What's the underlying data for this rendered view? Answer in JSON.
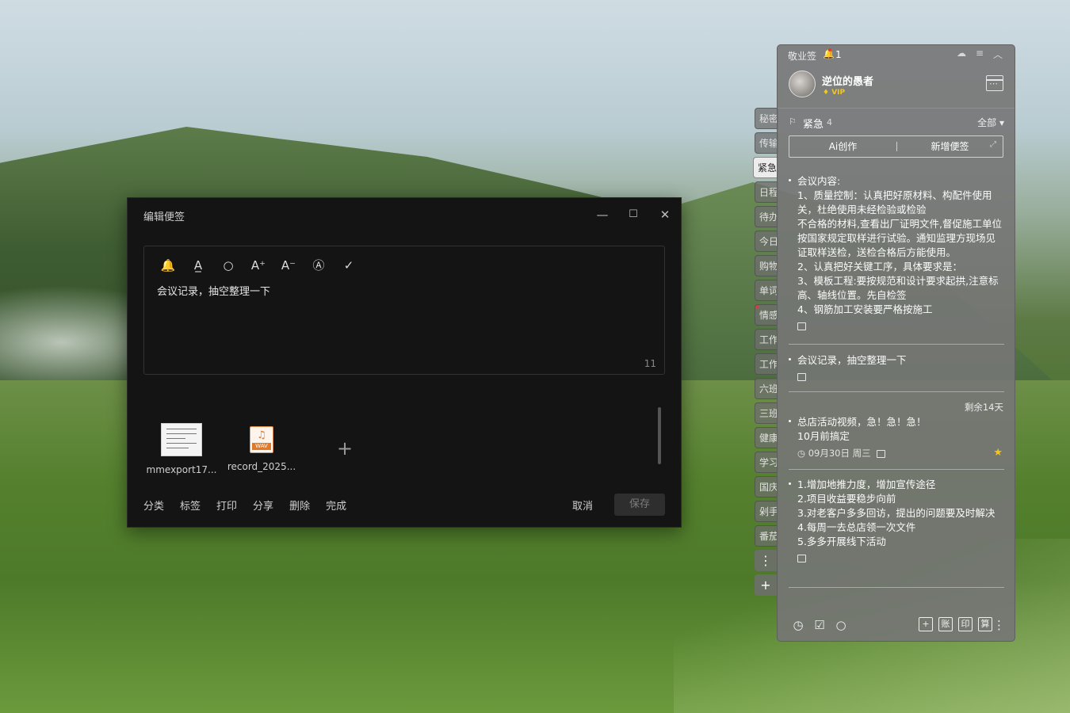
{
  "editor": {
    "title": "编辑便签",
    "minimize": "—",
    "maximize": "☐",
    "close": "✕",
    "toolbar": [
      {
        "name": "reminder-icon",
        "glyph": "🔔"
      },
      {
        "name": "text-color-icon",
        "glyph": "A̲"
      },
      {
        "name": "search-icon",
        "glyph": "○"
      },
      {
        "name": "font-increase-icon",
        "glyph": "A⁺"
      },
      {
        "name": "font-decrease-icon",
        "glyph": "A⁻"
      },
      {
        "name": "font-style-icon",
        "glyph": "Ⓐ"
      },
      {
        "name": "done-check-icon",
        "glyph": "✓"
      }
    ],
    "text": "会议记录，抽空整理一下",
    "char_count": "11",
    "attachments": [
      {
        "name": "mmexport17...",
        "type": "image"
      },
      {
        "name": "record_2025...",
        "type": "wav",
        "label": "WAV",
        "glyph": "♫"
      }
    ],
    "add_attachment": "+",
    "bottom_actions": [
      "分类",
      "标签",
      "打印",
      "分享",
      "删除",
      "完成"
    ],
    "cancel": "取消",
    "save": "保存"
  },
  "tabs": [
    "秘密",
    "传输",
    "紧急",
    "日程",
    "待办",
    "今日",
    "购物",
    "单词",
    "情感",
    "工作",
    "工作",
    "六班",
    "三班",
    "健康",
    "学习",
    "国庆",
    "剁手",
    "番茄"
  ],
  "tab_tools": {
    "more": "⋮",
    "add": "+"
  },
  "panel": {
    "app_name": "敬业签",
    "bell_glyph": "🔔",
    "notification_count": "1",
    "controls": [
      "☁",
      "≡",
      "︿"
    ],
    "user": {
      "name": "逆位的愚者",
      "badge": "VIP"
    },
    "category": {
      "flag": "⚐",
      "name": "紧急",
      "count": "4",
      "filter": "全部 ▾"
    },
    "ai_button": "Ai创作",
    "new_button": "新增便签",
    "expand_glyph": "⤢",
    "notes": [
      {
        "body": "会议内容:\n1、质量控制：认真把好原材料、构配件使用关，杜绝使用未经检验或检验\n不合格的材料,查看出厂证明文件,督促施工单位按国家规定取样进行试验。通知监理方现场见证取样送检，送检合格后方能使用。\n2、认真把好关键工序，具体要求是：\n3、模板工程:要按规范和设计要求起拱,注意标高、轴线位置。先自检签\n4、钢筋加工安装要严格按施工"
      },
      {
        "body": "会议记录，抽空整理一下"
      },
      {
        "body": "总店活动视频，急！急！急！\n10月前搞定",
        "date": "09月30日 周三",
        "starred": true
      },
      {
        "body": "1.增加地推力度，增加宣传途径\n2.项目收益要稳步向前\n3.对老客户多多回访，提出的问题要及时解决\n4.每周一去总店领一次文件\n5.多多开展线下活动"
      }
    ],
    "remaining": "剩余14天",
    "bottom_left": [
      "◷",
      "☑",
      "○"
    ],
    "bottom_right": [
      "+",
      "账",
      "印",
      "算"
    ],
    "bottom_more": "⋮"
  },
  "colors": {
    "accent_star": "#f5c518",
    "alert_red": "#e53935",
    "wav_orange": "#e07a2a"
  }
}
